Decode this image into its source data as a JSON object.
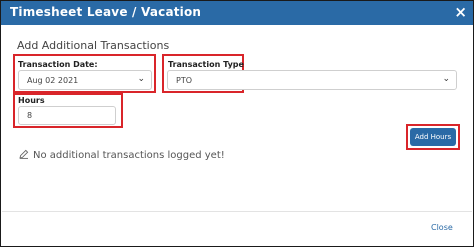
{
  "dialog": {
    "title": "Timesheet Leave / Vacation",
    "close_glyph": "×",
    "section_title": "Add Additional Transactions"
  },
  "form": {
    "transaction_date": {
      "label": "Transaction Date:",
      "value": "Aug 02 2021"
    },
    "transaction_type": {
      "label": "Transaction Type",
      "value": "PTO"
    },
    "hours": {
      "label": "Hours",
      "value": "8"
    }
  },
  "actions": {
    "add_hours_label": "Add Hours",
    "close_label": "Close"
  },
  "empty_state": {
    "icon": "pencil-icon",
    "message": "No additional transactions logged yet!"
  },
  "colors": {
    "title_bar": "#2a6aa6",
    "highlight": "#d9252a",
    "primary_button": "#2a6aa6"
  }
}
